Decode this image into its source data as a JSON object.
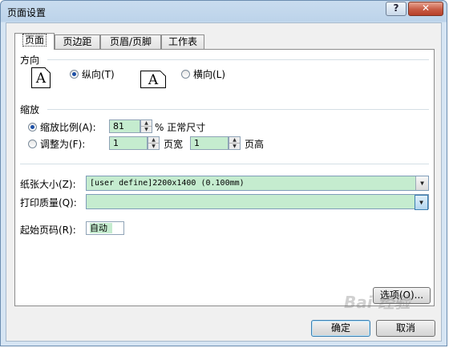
{
  "window": {
    "title": "页面设置",
    "help_glyph": "?",
    "close_glyph": "✕"
  },
  "tabs": [
    {
      "label": "页面",
      "active": true
    },
    {
      "label": "页边距",
      "active": false
    },
    {
      "label": "页眉/页脚",
      "active": false
    },
    {
      "label": "工作表",
      "active": false
    }
  ],
  "orientation": {
    "label": "方向",
    "portrait": {
      "icon_glyph": "A",
      "label": "纵向(T)",
      "selected": true
    },
    "landscape": {
      "icon_glyph": "A",
      "label": "横向(L)",
      "selected": false
    }
  },
  "scaling": {
    "label": "缩放",
    "adjust_to": {
      "label": "缩放比例(A):",
      "value": "81",
      "suffix": "% 正常尺寸",
      "selected": true
    },
    "fit_to": {
      "label": "调整为(F):",
      "selected": false,
      "pages_wide": "1",
      "pages_wide_suffix": "页宽",
      "pages_tall": "1",
      "pages_tall_suffix": "页高"
    }
  },
  "paper_size": {
    "label": "纸张大小(Z):",
    "value": "[user define]2200x1400 (0.100mm)"
  },
  "print_quality": {
    "label": "打印质量(Q):",
    "value": ""
  },
  "first_page_number": {
    "label": "起始页码(R):",
    "value": "自动"
  },
  "buttons": {
    "options": "选项(O)...",
    "ok": "确定",
    "cancel": "取消"
  },
  "watermark": "Bai 经验",
  "colors": {
    "field_fill": "#c5eccf",
    "close_red": "#c75b44",
    "selected_radio": "#1c4fa6"
  }
}
